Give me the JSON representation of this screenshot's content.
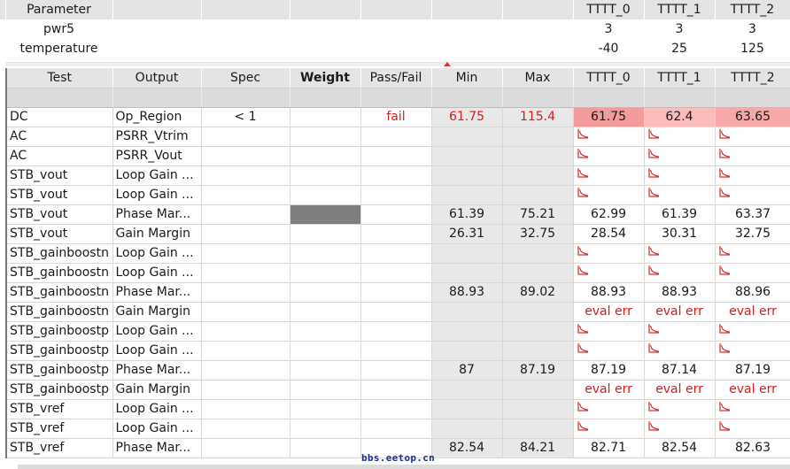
{
  "params": {
    "headers": [
      "",
      "Parameter",
      "",
      "",
      "",
      "",
      "",
      "",
      "TTTT_0",
      "TTTT_1",
      "TTTT_2"
    ],
    "rows": [
      [
        "",
        "pwr5",
        "",
        "",
        "",
        "",
        "",
        "",
        "3",
        "3",
        "3"
      ],
      [
        "",
        "temperature",
        "",
        "",
        "",
        "",
        "",
        "",
        "-40",
        "25",
        "125"
      ]
    ]
  },
  "results": {
    "headers": [
      "Test",
      "Output",
      "Spec",
      "Weight",
      "Pass/Fail",
      "Min",
      "Max",
      "TTTT_0",
      "TTTT_1",
      "TTTT_2"
    ],
    "rows": [
      {
        "test": "DC",
        "output": "Op_Region",
        "spec": "< 1",
        "pass_fail": "fail",
        "min": "61.75",
        "max": "115.4",
        "t0": "61.75",
        "t1": "62.4",
        "t2": "63.65"
      },
      {
        "test": "AC",
        "output": "PSRR_Vtrim",
        "spec": "",
        "pass_fail": "",
        "min": "",
        "max": "",
        "t0": "",
        "t1": "",
        "t2": ""
      },
      {
        "test": "AC",
        "output": "PSRR_Vout",
        "spec": "",
        "pass_fail": "",
        "min": "",
        "max": "",
        "t0": "",
        "t1": "",
        "t2": ""
      },
      {
        "test": "STB_vout",
        "output": "Loop Gain ...",
        "spec": "",
        "pass_fail": "",
        "min": "",
        "max": "",
        "t0": "",
        "t1": "",
        "t2": ""
      },
      {
        "test": "STB_vout",
        "output": "Loop Gain ...",
        "spec": "",
        "pass_fail": "",
        "min": "",
        "max": "",
        "t0": "",
        "t1": "",
        "t2": ""
      },
      {
        "test": "STB_vout",
        "output": "Phase Mar...",
        "spec": "",
        "pass_fail": "",
        "min": "61.39",
        "max": "75.21",
        "t0": "62.99",
        "t1": "61.39",
        "t2": "63.37"
      },
      {
        "test": "STB_vout",
        "output": "Gain Margin",
        "spec": "",
        "pass_fail": "",
        "min": "26.31",
        "max": "32.75",
        "t0": "28.54",
        "t1": "30.31",
        "t2": "32.75"
      },
      {
        "test": "STB_gainboostn",
        "output": "Loop Gain ...",
        "spec": "",
        "pass_fail": "",
        "min": "",
        "max": "",
        "t0": "",
        "t1": "",
        "t2": ""
      },
      {
        "test": "STB_gainboostn",
        "output": "Loop Gain ...",
        "spec": "",
        "pass_fail": "",
        "min": "",
        "max": "",
        "t0": "",
        "t1": "",
        "t2": ""
      },
      {
        "test": "STB_gainboostn",
        "output": "Phase Mar...",
        "spec": "",
        "pass_fail": "",
        "min": "88.93",
        "max": "89.02",
        "t0": "88.93",
        "t1": "88.93",
        "t2": "88.96"
      },
      {
        "test": "STB_gainboostn",
        "output": "Gain Margin",
        "spec": "",
        "pass_fail": "",
        "min": "",
        "max": "",
        "t0": "eval err",
        "t1": "eval err",
        "t2": "eval err"
      },
      {
        "test": "STB_gainboostp",
        "output": "Loop Gain ...",
        "spec": "",
        "pass_fail": "",
        "min": "",
        "max": "",
        "t0": "",
        "t1": "",
        "t2": ""
      },
      {
        "test": "STB_gainboostp",
        "output": "Loop Gain ...",
        "spec": "",
        "pass_fail": "",
        "min": "",
        "max": "",
        "t0": "",
        "t1": "",
        "t2": ""
      },
      {
        "test": "STB_gainboostp",
        "output": "Phase Mar...",
        "spec": "",
        "pass_fail": "",
        "min": "87",
        "max": "87.19",
        "t0": "87.19",
        "t1": "87.14",
        "t2": "87.19"
      },
      {
        "test": "STB_gainboostp",
        "output": "Gain Margin",
        "spec": "",
        "pass_fail": "",
        "min": "",
        "max": "",
        "t0": "eval err",
        "t1": "eval err",
        "t2": "eval err"
      },
      {
        "test": "STB_vref",
        "output": "Loop Gain ...",
        "spec": "",
        "pass_fail": "",
        "min": "",
        "max": "",
        "t0": "",
        "t1": "",
        "t2": ""
      },
      {
        "test": "STB_vref",
        "output": "Loop Gain ...",
        "spec": "",
        "pass_fail": "",
        "min": "",
        "max": "",
        "t0": "",
        "t1": "",
        "t2": ""
      },
      {
        "test": "STB_vref",
        "output": "Phase Mar...",
        "spec": "",
        "pass_fail": "",
        "min": "82.54",
        "max": "84.21",
        "t0": "82.71",
        "t1": "82.54",
        "t2": "82.63"
      }
    ]
  },
  "watermark": "bbs.eetop.cn",
  "icons": {
    "waveform": "waveform-plot-icon"
  },
  "colors": {
    "fail_text": "#e01818",
    "highlight_strong": "#f49b9b",
    "highlight_light": "#fbbcbc",
    "header_bg": "#e4e4e4",
    "cell_gray": "#e8e8e8",
    "weight_fill": "#7e7e7e"
  }
}
